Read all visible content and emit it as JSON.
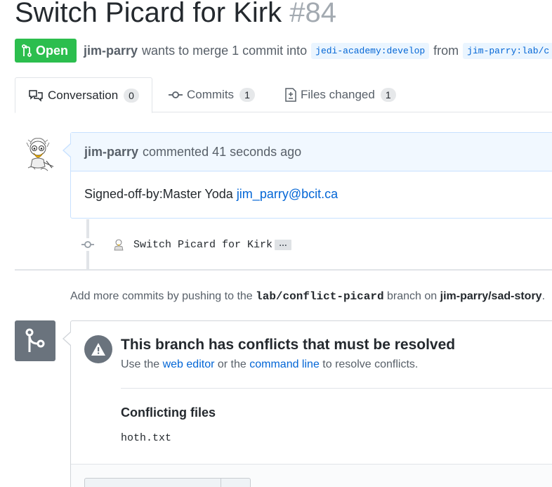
{
  "pr": {
    "title": "Switch Picard for Kirk",
    "number": "#84",
    "state": "Open",
    "author": "jim-parry",
    "merge_text": "wants to merge 1 commit into",
    "base_branch": "jedi-academy:develop",
    "from_text": "from",
    "head_branch": "jim-parry:lab/c"
  },
  "tabs": [
    {
      "label": "Conversation",
      "count": "0"
    },
    {
      "label": "Commits",
      "count": "1"
    },
    {
      "label": "Files changed",
      "count": "1"
    }
  ],
  "comment": {
    "author": "jim-parry",
    "action": "commented 41 seconds ago",
    "body": "Signed-off-by:Master Yoda ",
    "email": "jim_parry@bcit.ca"
  },
  "commit": {
    "message": "Switch Picard for Kirk",
    "more": "…"
  },
  "push_hint": {
    "prefix": "Add more commits by pushing to the ",
    "branch": "lab/conflict-picard",
    "middle": " branch on ",
    "repo": "jim-parry/sad-story",
    "suffix": "."
  },
  "merge": {
    "title": "This branch has conflicts that must be resolved",
    "sub_prefix": "Use the ",
    "web_editor": "web editor",
    "sub_middle": " or the ",
    "command_line": "command line",
    "sub_suffix": " to resolve conflicts.",
    "files_heading": "Conflicting files",
    "files": [
      "hoth.txt"
    ]
  },
  "colors": {
    "open_green": "#2cbe4e",
    "link_blue": "#0366d6",
    "comment_header_bg": "#f1f8ff"
  }
}
